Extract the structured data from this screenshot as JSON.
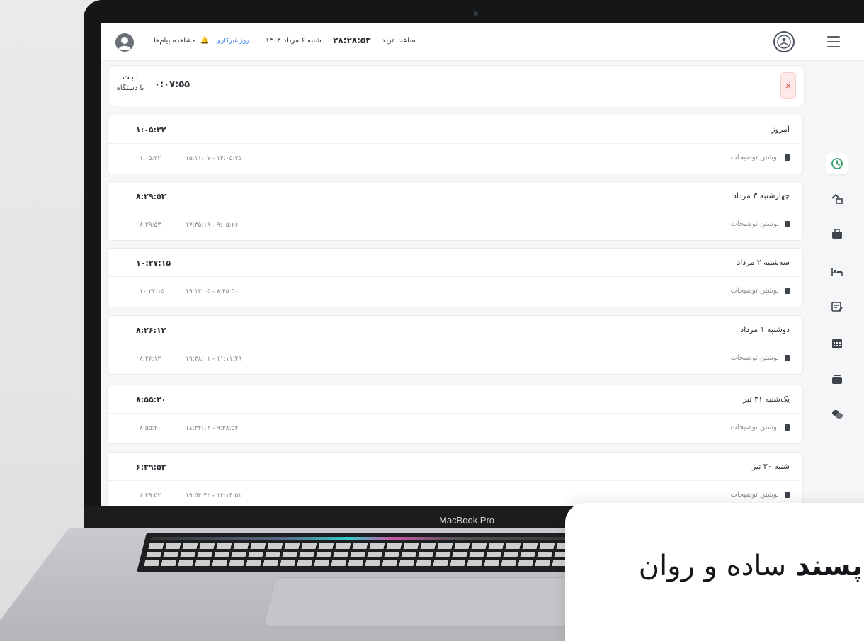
{
  "header": {
    "messages_label": "مشاهده پیام‌ها",
    "workday_label": "روز غیرکاری",
    "date": "شنبه ۶ مرداد ۱۴۰۳",
    "clock": "۲۸:۲۸:۵۳",
    "clock_label": "ساعت تردد"
  },
  "registration": {
    "label_line1": "ثـبـت",
    "label_line2": "با دستگاه",
    "time": "۰:۰۷:۵۵",
    "close": "×"
  },
  "days": [
    {
      "title": "امروز",
      "total": "۱:۰۵:۳۲",
      "duration": "۱:۰۵:۳۲",
      "range": "۱۵:۱۱:۰۷ - ۱۴:۰۵:۳۵",
      "note": "نوشتن توضیحات"
    },
    {
      "title": "چهارشنبه ۳ مرداد",
      "total": "۸:۲۹:۵۳",
      "duration": "۸:۲۹:۵۳",
      "range": "۱۷:۳۵:۱۹ - ۹:۰۵:۲۶",
      "note": "نوشتن توضیحات"
    },
    {
      "title": "سه‌شنبه ۲ مرداد",
      "total": "۱۰:۲۷:۱۵",
      "duration": "۱۰:۲۷:۱۵",
      "range": "۱۹:۱۳:۰۵ - ۸:۴۵:۵۰",
      "note": "نوشتن توضیحات"
    },
    {
      "title": "دوشنبه ۱ مرداد",
      "total": "۸:۲۶:۱۲",
      "duration": "۸:۲۶:۱۲",
      "range": "۱۹:۳۸:۰۱ - ۱۱:۱۱:۴۹",
      "note": "نوشتن توضیحات"
    },
    {
      "title": "یک‌شنبه ۳۱ تیر",
      "total": "۸:۵۵:۲۰",
      "duration": "۸:۵۵:۲۰",
      "range": "۱۸:۳۴:۱۴ - ۹:۳۸:۵۴",
      "note": "نوشتن توضیحات"
    },
    {
      "title": "شنبه ۳۰ تیر",
      "total": "۶:۳۹:۵۳",
      "duration": "۶:۳۹:۵۲",
      "range": "۱۹:۵۴:۴۳ - ۱۳:۱۴:۵۱",
      "note": "نوشتن توضیحات"
    }
  ],
  "sidebar": {
    "items": [
      {
        "icon": "timer-icon",
        "active": true
      },
      {
        "icon": "home-transfer-icon"
      },
      {
        "icon": "briefcase-icon"
      },
      {
        "icon": "bed-icon"
      },
      {
        "icon": "calendar-edit-icon"
      },
      {
        "icon": "calendar-grid-icon"
      },
      {
        "icon": "card-stack-icon"
      },
      {
        "icon": "chat-bubbles-icon"
      }
    ]
  },
  "device": {
    "label": "MacBook Pro"
  },
  "promo": {
    "bold": "پسند",
    "rest": "ساده و روان"
  },
  "colors": {
    "accent_green": "#27a36a",
    "link_blue": "#2f7de1",
    "close_red": "#e05252"
  }
}
